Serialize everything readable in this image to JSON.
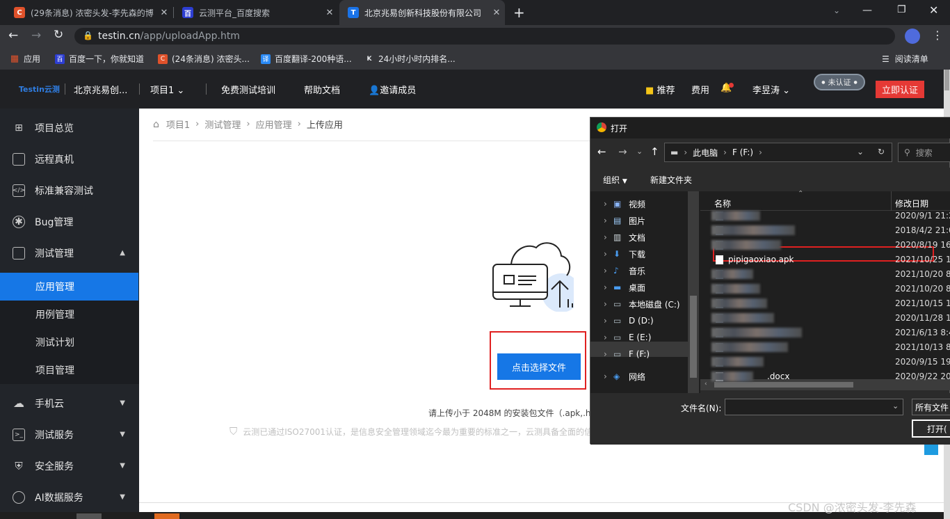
{
  "browser": {
    "tabs": [
      {
        "title": "(29条消息) 浓密头发-李先森的博",
        "icon_color": "#e0522b",
        "icon_text": "C"
      },
      {
        "title": "云测平台_百度搜索",
        "icon_color": "#2d3ed2",
        "icon_text": "百"
      },
      {
        "title": "北京兆易创新科技股份有限公司",
        "icon_color": "#1a73e8",
        "icon_text": "T"
      }
    ],
    "url_host": "testin.cn",
    "url_path": "/app/uploadApp.htm",
    "bookmarks": [
      {
        "label": "应用",
        "icon": "apps-grid-icon"
      },
      {
        "label": "百度一下，你就知道",
        "icon": "baidu-icon"
      },
      {
        "label": "(24条消息) 浓密头...",
        "icon": "csdn-icon"
      },
      {
        "label": "百度翻译-200种语...",
        "icon": "translate-icon"
      },
      {
        "label": "24小时小时内排名...",
        "icon": "k-icon"
      }
    ],
    "reading_list": "阅读清单"
  },
  "header": {
    "logo": "Testin云测",
    "company": "北京兆易创...",
    "project": "项目1",
    "nav": [
      "免费测试培训",
      "帮助文档",
      "邀请成员"
    ],
    "recommend": "推荐",
    "fees": "费用",
    "user": "李昱涛",
    "cert_badge": "未认证",
    "cert_button": "立即认证"
  },
  "sidebar": {
    "items": [
      {
        "label": "项目总览",
        "icon": "grid-icon"
      },
      {
        "label": "远程真机",
        "icon": "device-icon"
      },
      {
        "label": "标准兼容测试",
        "icon": "code-icon"
      },
      {
        "label": "Bug管理",
        "icon": "bug-icon"
      },
      {
        "label": "测试管理",
        "icon": "document-icon"
      }
    ],
    "sub_items": [
      "应用管理",
      "用例管理",
      "测试计划",
      "项目管理"
    ],
    "bottom_items": [
      {
        "label": "手机云",
        "icon": "cloud-icon"
      },
      {
        "label": "测试服务",
        "icon": "terminal-icon"
      },
      {
        "label": "安全服务",
        "icon": "shield-icon"
      },
      {
        "label": "AI数据服务",
        "icon": "ai-icon"
      }
    ]
  },
  "breadcrumb": [
    "项目1",
    "测试管理",
    "应用管理",
    "上传应用"
  ],
  "upload": {
    "button": "点击选择文件",
    "hint": "请上传小于 2048M 的安装包文件（.apk,.ha",
    "security": "云测已通过ISO27001认证，是信息安全管理领域迄今最为重要的标准之一，云测具备全面的信"
  },
  "dialog": {
    "title": "打开",
    "path": [
      "此电脑",
      "F (F:)"
    ],
    "search_placeholder": "搜索",
    "toolbar": {
      "organize": "组织",
      "new_folder": "新建文件夹"
    },
    "nav_items": [
      {
        "label": "视频",
        "icon": "video-icon"
      },
      {
        "label": "图片",
        "icon": "picture-icon"
      },
      {
        "label": "文档",
        "icon": "docs-icon"
      },
      {
        "label": "下载",
        "icon": "download-icon"
      },
      {
        "label": "音乐",
        "icon": "music-icon"
      },
      {
        "label": "桌面",
        "icon": "desktop-icon"
      },
      {
        "label": "本地磁盘 (C:)",
        "icon": "drive-icon"
      },
      {
        "label": "D (D:)",
        "icon": "drive-icon"
      },
      {
        "label": "E (E:)",
        "icon": "drive-icon"
      },
      {
        "label": "F (F:)",
        "icon": "drive-icon"
      },
      {
        "label": "网络",
        "icon": "network-icon"
      }
    ],
    "columns": {
      "name": "名称",
      "modified": "修改日期"
    },
    "files": [
      {
        "name": "",
        "date": "2020/9/1 21:2"
      },
      {
        "name": "",
        "date": "2018/4/2 21:0"
      },
      {
        "name": "",
        "date": "2020/8/19 16:"
      },
      {
        "name": "pipigaoxiao.apk",
        "date": "2021/10/25 1"
      },
      {
        "name": "",
        "date": "2021/10/20 8"
      },
      {
        "name": "",
        "date": "2021/10/20 8"
      },
      {
        "name": "",
        "date": "2021/10/15 1"
      },
      {
        "name": "",
        "date": "2020/11/28 1"
      },
      {
        "name": "",
        "date": "2021/6/13 8:4"
      },
      {
        "name": "",
        "date": "2021/10/13 8"
      },
      {
        "name": "",
        "date": "2020/9/15 19"
      },
      {
        "name": ".docx",
        "date": "2020/9/22 20"
      }
    ],
    "filename_label": "文件名(N):",
    "filter": "所有文件",
    "open_button": "打开("
  },
  "watermark": "CSDN @浓密头发-李先森"
}
